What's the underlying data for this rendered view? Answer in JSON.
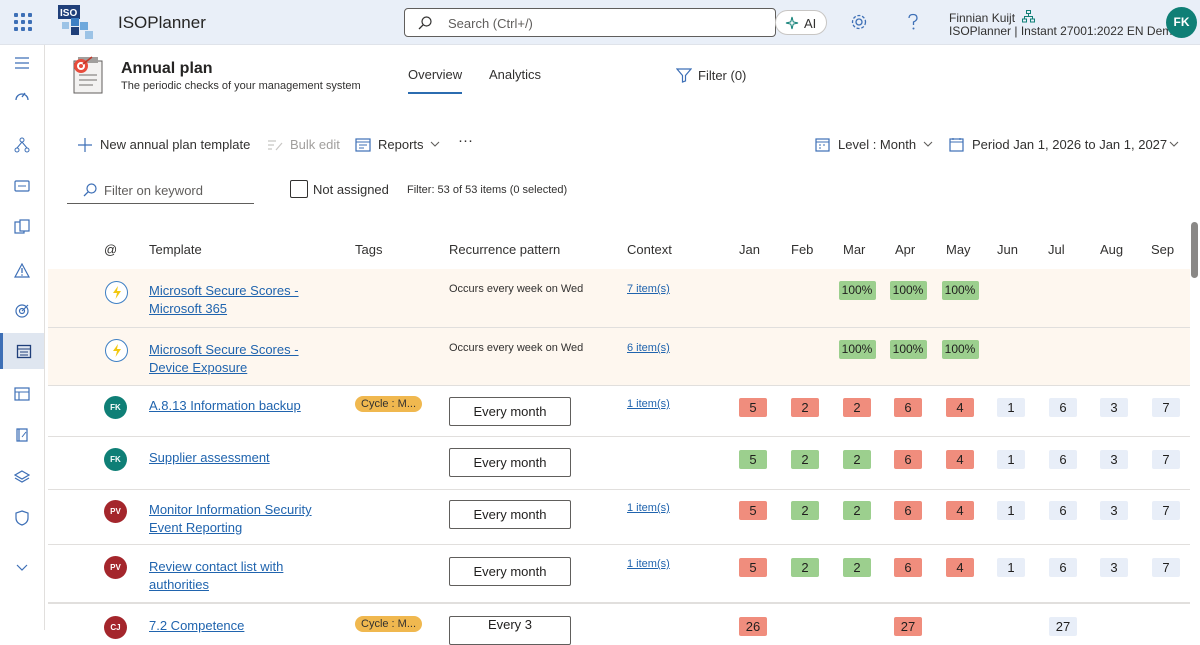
{
  "app": {
    "title": "ISOPlanner",
    "logo_text": "ISO"
  },
  "search": {
    "placeholder": "Search (Ctrl+/)"
  },
  "ai_label": "AI",
  "user": {
    "name": "Finnian Kuijt",
    "org": "ISOPlanner | Instant 27001:2022 EN Demo",
    "initials": "FK"
  },
  "page": {
    "title": "Annual plan",
    "subtitle": "The periodic checks of your management system"
  },
  "tabs": [
    {
      "label": "Overview",
      "selected": true
    },
    {
      "label": "Analytics",
      "selected": false
    }
  ],
  "filter_label": "Filter (0)",
  "commands": {
    "new_template": "New annual plan template",
    "bulk_edit": "Bulk edit",
    "reports": "Reports",
    "more": "···",
    "level": "Level : Month",
    "period": "Period Jan 1, 2026 to Jan 1, 2027"
  },
  "filters": {
    "keyword_placeholder": "Filter on keyword",
    "not_assigned": "Not assigned",
    "count_text": "Filter: 53 of 53 items (0 selected)"
  },
  "table": {
    "headers": [
      "@",
      "Template",
      "Tags",
      "Recurrence pattern",
      "Context"
    ],
    "months": [
      "Jan",
      "Feb",
      "Mar",
      "Apr",
      "May",
      "Jun",
      "Jul",
      "Aug",
      "Sep"
    ],
    "rows": [
      {
        "icon": "bolt-icon",
        "template": "Microsoft Secure Scores - Microsoft 365",
        "recurrence": "Occurs every week on Wed",
        "context": "7 item(s)",
        "cells": [
          "",
          "",
          "100%",
          "100%",
          "100%",
          "",
          "",
          "",
          ""
        ]
      },
      {
        "icon": "bolt-icon",
        "template": "Microsoft Secure Scores - Device Exposure",
        "recurrence": "Occurs every week on Wed",
        "context": "6 item(s)",
        "cells": [
          "",
          "",
          "100%",
          "100%",
          "100%",
          "",
          "",
          "",
          ""
        ]
      },
      {
        "initials": "FK",
        "avatar_color": "#0f7f76",
        "template": "A.8.13 Information backup",
        "tag": "Cycle : M...",
        "recurrence": "Every month",
        "context": "1 item(s)",
        "cells": [
          "5",
          "2",
          "2",
          "6",
          "4",
          "1",
          "6",
          "3",
          "7"
        ],
        "states": [
          "red",
          "red",
          "red",
          "red",
          "red",
          "blue",
          "blue",
          "blue",
          "blue"
        ]
      },
      {
        "initials": "FK",
        "avatar_color": "#0f7f76",
        "template": "Supplier assessment",
        "recurrence": "Every month",
        "cells": [
          "5",
          "2",
          "2",
          "6",
          "4",
          "1",
          "6",
          "3",
          "7"
        ],
        "states": [
          "green",
          "green",
          "green",
          "red",
          "red",
          "blue",
          "blue",
          "blue",
          "blue"
        ]
      },
      {
        "initials": "PV",
        "avatar_color": "#a4262c",
        "template": "Monitor Information Security Event Reporting",
        "recurrence": "Every month",
        "context": "1 item(s)",
        "cells": [
          "5",
          "2",
          "2",
          "6",
          "4",
          "1",
          "6",
          "3",
          "7"
        ],
        "states": [
          "red",
          "green",
          "green",
          "red",
          "red",
          "blue",
          "blue",
          "blue",
          "blue"
        ]
      },
      {
        "initials": "PV",
        "avatar_color": "#a4262c",
        "template": "Review contact list with authorities",
        "recurrence": "Every month",
        "context": "1 item(s)",
        "cells": [
          "5",
          "2",
          "2",
          "6",
          "4",
          "1",
          "6",
          "3",
          "7"
        ],
        "states": [
          "red",
          "green",
          "green",
          "red",
          "red",
          "blue",
          "blue",
          "blue",
          "blue"
        ]
      },
      {
        "initials": "CJ",
        "avatar_color": "#a4262c",
        "template": "7.2 Competence",
        "tag": "Cycle : M...",
        "recurrence": "Every 3",
        "cells": [
          "26",
          "",
          "",
          "27",
          "",
          "",
          "27",
          "",
          ""
        ],
        "states": [
          "red",
          "",
          "",
          "red",
          "",
          "",
          "blue",
          "",
          ""
        ]
      }
    ]
  },
  "colors": {
    "accent": "#2b6cb0",
    "topbar": "#e9eff8",
    "green": "#9ccf8e",
    "red": "#f08d7d",
    "highlight": "#fef7ef"
  }
}
